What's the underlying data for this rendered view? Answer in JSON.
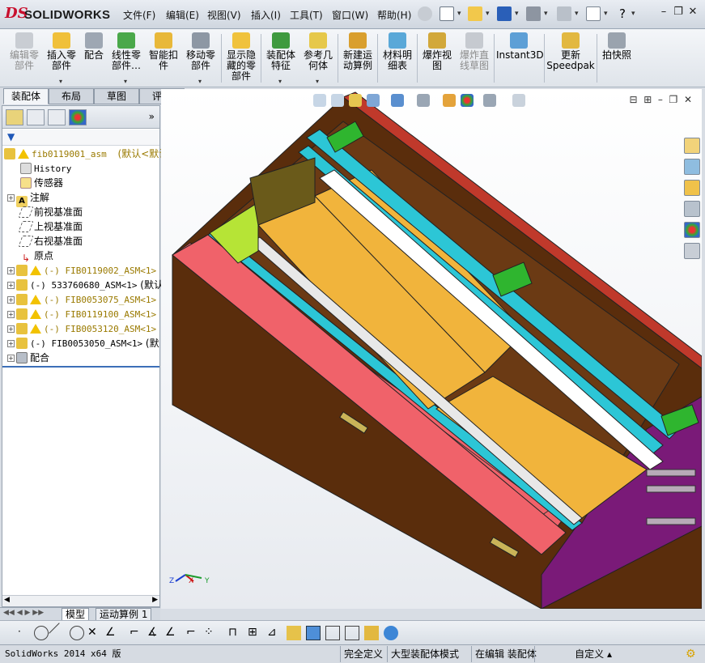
{
  "app": {
    "logo_ds": "DS",
    "logo_text": "SOLIDWORKS"
  },
  "menu": {
    "items": [
      "文件(F)",
      "编辑(E)",
      "视图(V)",
      "插入(I)",
      "工具(T)",
      "窗口(W)",
      "帮助(H)"
    ]
  },
  "commands": {
    "items": [
      {
        "label1": "编辑零",
        "label2": "部件",
        "label3": "",
        "disabled": true
      },
      {
        "label1": "插入零",
        "label2": "部件",
        "label3": "",
        "disabled": false
      },
      {
        "label1": "配合",
        "label2": "",
        "label3": "",
        "disabled": false
      },
      {
        "label1": "线性零",
        "label2": "部件…",
        "label3": "",
        "disabled": false
      },
      {
        "label1": "智能扣",
        "label2": "件",
        "label3": "",
        "disabled": false
      },
      {
        "label1": "移动零",
        "label2": "部件",
        "label3": "",
        "disabled": false
      },
      {
        "label1": "显示隐",
        "label2": "藏的零",
        "label3": "部件",
        "disabled": false
      },
      {
        "label1": "装配体",
        "label2": "特征",
        "label3": "",
        "disabled": false
      },
      {
        "label1": "参考几",
        "label2": "何体",
        "label3": "",
        "disabled": false
      },
      {
        "label1": "新建运",
        "label2": "动算例",
        "label3": "",
        "disabled": false
      },
      {
        "label1": "材料明",
        "label2": "细表",
        "label3": "",
        "disabled": false
      },
      {
        "label1": "爆炸视",
        "label2": "图",
        "label3": "",
        "disabled": false
      },
      {
        "label1": "爆炸直",
        "label2": "线草图",
        "label3": "",
        "disabled": true
      },
      {
        "label1": "Instant3D",
        "label2": "",
        "label3": "",
        "disabled": false
      },
      {
        "label1": "更新",
        "label2": "Speedpak",
        "label3": "",
        "disabled": false
      },
      {
        "label1": "拍快照",
        "label2": "",
        "label3": "",
        "disabled": false
      }
    ]
  },
  "cmd_tabs": [
    "装配体",
    "布局",
    "草图",
    "评估"
  ],
  "tree": {
    "root": "fib0119001_asm",
    "root_config": "(默认<默认",
    "history": "History",
    "sensors": "传感器",
    "annotations": "注解",
    "front_plane": "前视基准面",
    "top_plane": "上视基准面",
    "right_plane": "右视基准面",
    "origin": "原点",
    "components": [
      {
        "name": "(-) FIB0119002_ASM<1>",
        "extra": "",
        "warn": true
      },
      {
        "name": "(-) 533760680_ASM<1>",
        "extra": "(默认",
        "warn": false
      },
      {
        "name": "(-) FIB0053075_ASM<1>",
        "extra": "",
        "warn": true
      },
      {
        "name": "(-) FIB0119100_ASM<1>",
        "extra": "",
        "warn": true
      },
      {
        "name": "(-) FIB0053120_ASM<1>",
        "extra": "",
        "warn": true
      },
      {
        "name": "(-) FIB0053050_ASM<1>",
        "extra": "(默",
        "warn": false
      }
    ],
    "mates": "配合"
  },
  "bottom_tabs": [
    "模型",
    "运动算例 1"
  ],
  "triad": {
    "z": "Z",
    "x": "X",
    "y": "Y"
  },
  "status": {
    "version": "SolidWorks 2014 x64 版",
    "defined": "完全定义",
    "mode": "大型装配体模式",
    "editing": "在编辑 装配体",
    "units": "自定义"
  },
  "colors": {
    "model_brown": "#5a2d0c",
    "model_red": "#f0626a",
    "model_cyan": "#2cc6d6",
    "model_orange": "#f1b43c",
    "model_purple": "#7a1a78",
    "model_green": "#2fb52f",
    "model_lime": "#b6e436"
  }
}
